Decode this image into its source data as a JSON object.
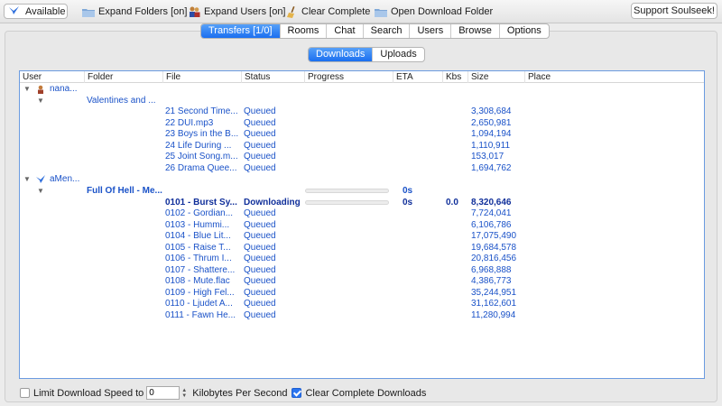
{
  "toolbar": {
    "status_label": "Available",
    "expand_folders": "Expand Folders [on]",
    "expand_users": "Expand Users [on]",
    "clear_complete": "Clear Complete",
    "open_download_folder": "Open Download Folder",
    "support": "Support Soulseek!"
  },
  "tabs": [
    "Transfers [1/0]",
    "Rooms",
    "Chat",
    "Search",
    "Users",
    "Browse",
    "Options"
  ],
  "active_tab": 0,
  "subtabs": [
    "Downloads",
    "Uploads"
  ],
  "active_subtab": 0,
  "columns": [
    "User",
    "Folder",
    "File",
    "Status",
    "Progress",
    "ETA",
    "Kbs",
    "Size",
    "Place"
  ],
  "groups": [
    {
      "user": "nana...",
      "folder": "Valentines and ...",
      "files": [
        {
          "file": "21 Second Time...",
          "status": "Queued",
          "size": "3,308,684"
        },
        {
          "file": "22 DUI.mp3",
          "status": "Queued",
          "size": "2,650,981"
        },
        {
          "file": "23 Boys in the B...",
          "status": "Queued",
          "size": "1,094,194"
        },
        {
          "file": "24 Life During ...",
          "status": "Queued",
          "size": "1,110,911"
        },
        {
          "file": "25 Joint Song.m...",
          "status": "Queued",
          "size": "153,017"
        },
        {
          "file": "26 Drama Quee...",
          "status": "Queued",
          "size": "1,694,762"
        }
      ]
    },
    {
      "user": "aMen...",
      "folder": "Full Of Hell - Me...",
      "folder_eta": "0s",
      "files": [
        {
          "file": "0101 - Burst Sy...",
          "status": "Downloading",
          "eta": "0s",
          "kbs": "0.0",
          "size": "8,320,646",
          "active": true,
          "progress": 0
        },
        {
          "file": "0102 - Gordian...",
          "status": "Queued",
          "size": "7,724,041"
        },
        {
          "file": "0103 - Hummi...",
          "status": "Queued",
          "size": "6,106,786"
        },
        {
          "file": "0104 - Blue Lit...",
          "status": "Queued",
          "size": "17,075,490"
        },
        {
          "file": "0105 - Raise T...",
          "status": "Queued",
          "size": "19,684,578"
        },
        {
          "file": "0106 - Thrum I...",
          "status": "Queued",
          "size": "20,816,456"
        },
        {
          "file": "0107 - Shattere...",
          "status": "Queued",
          "size": "6,968,888"
        },
        {
          "file": "0108 - Mute.flac",
          "status": "Queued",
          "size": "4,386,773"
        },
        {
          "file": "0109 - High Fel...",
          "status": "Queued",
          "size": "35,244,951"
        },
        {
          "file": "0110 - Ljudet A...",
          "status": "Queued",
          "size": "31,162,601"
        },
        {
          "file": "0111 - Fawn He...",
          "status": "Queued",
          "size": "11,280,994"
        }
      ]
    }
  ],
  "bottom": {
    "limit_label": "Limit Download Speed to",
    "limit_checked": false,
    "speed_value": "0",
    "unit_label": "Kilobytes Per Second",
    "clear_label": "Clear Complete Downloads",
    "clear_checked": true
  },
  "colors": {
    "accent": "#1b6ff0",
    "link_text": "#1a52c8"
  }
}
